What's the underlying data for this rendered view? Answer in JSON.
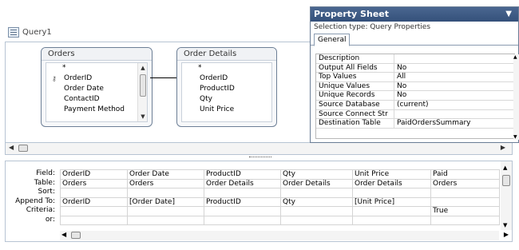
{
  "query_tab": {
    "label": "Query1",
    "icon": "query-design-icon"
  },
  "tables": {
    "orders": {
      "title": "Orders",
      "fields": [
        "*",
        "OrderID",
        "Order Date",
        "ContactID",
        "Payment Method"
      ]
    },
    "order_details": {
      "title": "Order Details",
      "fields": [
        "*",
        "OrderID",
        "ProductID",
        "Qty",
        "Unit Price"
      ]
    }
  },
  "property_sheet": {
    "title": "Property Sheet",
    "selection_type": "Selection type:  Query Properties",
    "tab": "General",
    "rows": [
      {
        "key": "Description",
        "value": ""
      },
      {
        "key": "Output All Fields",
        "value": "No"
      },
      {
        "key": "Top Values",
        "value": "All"
      },
      {
        "key": "Unique Values",
        "value": "No"
      },
      {
        "key": "Unique Records",
        "value": "No"
      },
      {
        "key": "Source Database",
        "value": "(current)"
      },
      {
        "key": "Source Connect Str",
        "value": ""
      },
      {
        "key": "Destination Table",
        "value": "PaidOrdersSummary"
      }
    ]
  },
  "grid": {
    "row_labels": [
      "Field:",
      "Table:",
      "Sort:",
      "Append To:",
      "Criteria:",
      "or:"
    ],
    "columns": [
      {
        "field": "OrderID",
        "table": "Orders",
        "sort": "",
        "append_to": "OrderID",
        "criteria": "",
        "or": ""
      },
      {
        "field": "Order Date",
        "table": "Orders",
        "sort": "",
        "append_to": "[Order Date]",
        "criteria": "",
        "or": ""
      },
      {
        "field": "ProductID",
        "table": "Order Details",
        "sort": "",
        "append_to": "ProductID",
        "criteria": "",
        "or": ""
      },
      {
        "field": "Qty",
        "table": "Order Details",
        "sort": "",
        "append_to": "Qty",
        "criteria": "",
        "or": ""
      },
      {
        "field": "Unit Price",
        "table": "Order Details",
        "sort": "",
        "append_to": "[Unit Price]",
        "criteria": "",
        "or": ""
      },
      {
        "field": "Paid",
        "table": "Orders",
        "sort": "",
        "append_to": "",
        "criteria": "True",
        "or": ""
      }
    ]
  }
}
